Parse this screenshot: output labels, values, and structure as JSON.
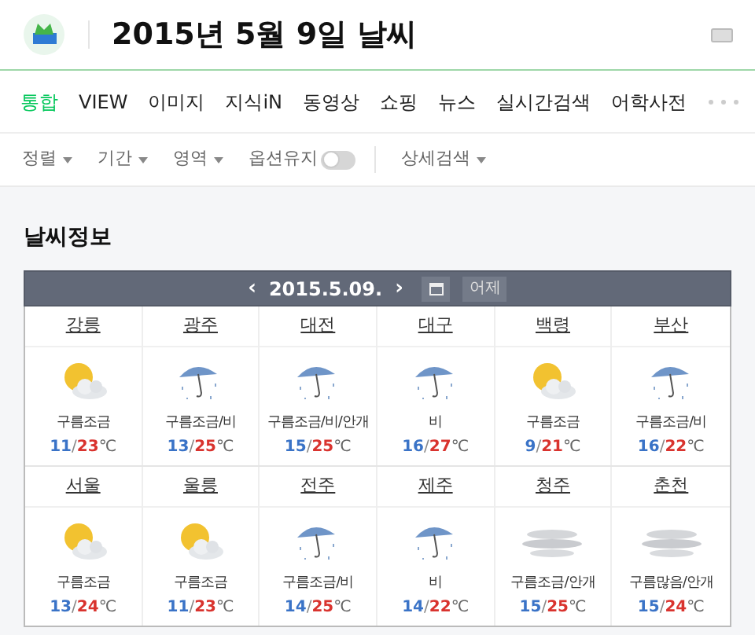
{
  "header": {
    "title": "2015년 5월 9일 날씨"
  },
  "tabs": [
    {
      "label": "통합",
      "selected": true
    },
    {
      "label": "VIEW",
      "selected": false
    },
    {
      "label": "이미지",
      "selected": false
    },
    {
      "label": "지식iN",
      "selected": false
    },
    {
      "label": "동영상",
      "selected": false
    },
    {
      "label": "쇼핑",
      "selected": false
    },
    {
      "label": "뉴스",
      "selected": false
    },
    {
      "label": "실시간검색",
      "selected": false
    },
    {
      "label": "어학사전",
      "selected": false
    }
  ],
  "filters": [
    {
      "kind": "dropdown",
      "label": "정렬"
    },
    {
      "kind": "dropdown",
      "label": "기간"
    },
    {
      "kind": "dropdown",
      "label": "영역"
    },
    {
      "kind": "toggle",
      "label": "옵션유지",
      "on": false
    },
    {
      "kind": "dropdown",
      "label": "상세검색"
    }
  ],
  "section_title": "날씨정보",
  "date_bar": {
    "prev": "‹",
    "date": "2015.5.09.",
    "next": "›",
    "yesterday": "어제"
  },
  "cities": [
    {
      "name": "강릉",
      "kind": "sun_cloud",
      "condition": "구름조금",
      "low": "11",
      "sep": "/",
      "high": "23",
      "unit": "℃"
    },
    {
      "name": "광주",
      "kind": "rain",
      "condition": "구름조금/비",
      "low": "13",
      "sep": "/",
      "high": "25",
      "unit": "℃"
    },
    {
      "name": "대전",
      "kind": "rain",
      "condition": "구름조금/비/안개",
      "low": "15",
      "sep": "/",
      "high": "25",
      "unit": "℃"
    },
    {
      "name": "대구",
      "kind": "rain",
      "condition": "비",
      "low": "16",
      "sep": "/",
      "high": "27",
      "unit": "℃"
    },
    {
      "name": "백령",
      "kind": "sun_cloud",
      "condition": "구름조금",
      "low": "9",
      "sep": "/",
      "high": "21",
      "unit": "℃"
    },
    {
      "name": "부산",
      "kind": "rain",
      "condition": "구름조금/비",
      "low": "16",
      "sep": "/",
      "high": "22",
      "unit": "℃"
    },
    {
      "name": "서울",
      "kind": "sun_cloud",
      "condition": "구름조금",
      "low": "13",
      "sep": "/",
      "high": "24",
      "unit": "℃"
    },
    {
      "name": "울릉",
      "kind": "sun_cloud",
      "condition": "구름조금",
      "low": "11",
      "sep": "/",
      "high": "23",
      "unit": "℃"
    },
    {
      "name": "전주",
      "kind": "rain",
      "condition": "구름조금/비",
      "low": "14",
      "sep": "/",
      "high": "25",
      "unit": "℃"
    },
    {
      "name": "제주",
      "kind": "rain",
      "condition": "비",
      "low": "14",
      "sep": "/",
      "high": "22",
      "unit": "℃"
    },
    {
      "name": "청주",
      "kind": "fog",
      "condition": "구름조금/안개",
      "low": "15",
      "sep": "/",
      "high": "25",
      "unit": "℃"
    },
    {
      "name": "춘천",
      "kind": "fog",
      "condition": "구름많음/안개",
      "low": "15",
      "sep": "/",
      "high": "24",
      "unit": "℃"
    }
  ]
}
